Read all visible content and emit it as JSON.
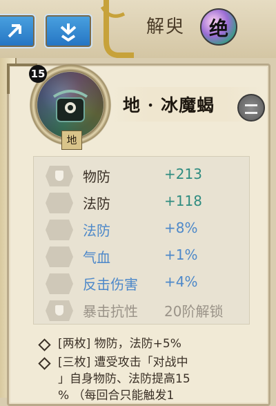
{
  "header": {
    "decode_label": "解臾",
    "rank_label": "绝"
  },
  "soul": {
    "level": "15",
    "element": "地",
    "name": "地 · 冰魔蝎"
  },
  "stats": [
    {
      "icon": "shield-icon",
      "label": "物防",
      "value": "+213",
      "style": "primary"
    },
    {
      "icon": "triple-orb-icon",
      "label": "法防",
      "value": "+118",
      "style": "primary"
    },
    {
      "icon": "triple-orb-icon",
      "label": "法防",
      "value": "+8%",
      "style": "secondary"
    },
    {
      "icon": "heart-icon",
      "label": "气血",
      "value": "+1%",
      "style": "secondary"
    },
    {
      "icon": "sword-icon",
      "label": "反击伤害",
      "value": "+4%",
      "style": "secondary"
    },
    {
      "icon": "shield-icon",
      "label": "暴击抗性",
      "value": "20阶解锁",
      "style": "locked"
    }
  ],
  "set_bonus": {
    "line1": "[两枚] 物防，法防+5%",
    "line2": "[三枚] 遭受攻击「对战中",
    "line3": "」自身物防、法防提高15",
    "line4": "% （每回合只能触发1"
  },
  "colors": {
    "primary_value": "#2f8c80",
    "secondary": "#4d88c9",
    "locked": "#9a9388",
    "tab_blue": "#2e86d0"
  }
}
